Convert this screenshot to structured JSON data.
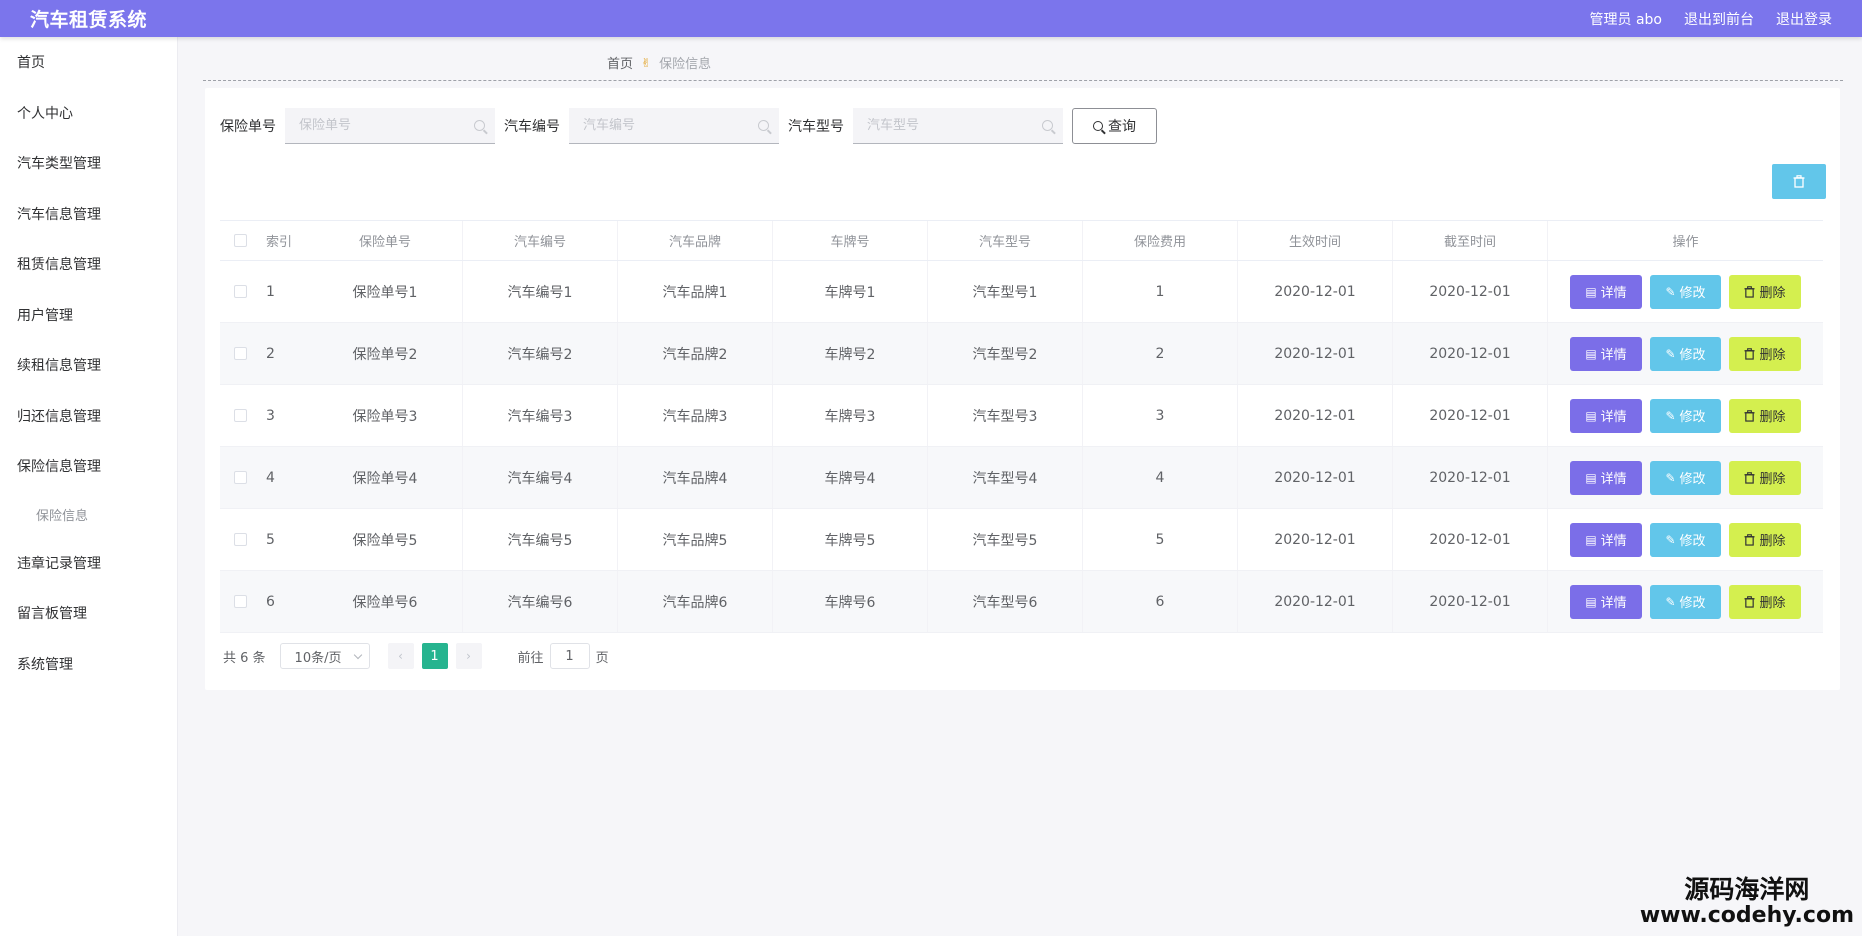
{
  "header": {
    "title": "汽车租赁系统",
    "admin": "管理员 abo",
    "back_to_front": "退出到前台",
    "logout": "退出登录"
  },
  "sidebar": {
    "items": [
      "首页",
      "个人中心",
      "汽车类型管理",
      "汽车信息管理",
      "租赁信息管理",
      "用户管理",
      "续租信息管理",
      "归还信息管理",
      "保险信息管理"
    ],
    "sub_item": "保险信息",
    "items_after": [
      "违章记录管理",
      "留言板管理",
      "系统管理"
    ]
  },
  "breadcrumb": {
    "home": "首页",
    "current": "保险信息"
  },
  "search": {
    "field1_label": "保险单号",
    "field1_placeholder": "保险单号",
    "field2_label": "汽车编号",
    "field2_placeholder": "汽车编号",
    "field3_label": "汽车型号",
    "field3_placeholder": "汽车型号",
    "query_label": "查询"
  },
  "table": {
    "headers": [
      "索引",
      "保险单号",
      "汽车编号",
      "汽车品牌",
      "车牌号",
      "汽车型号",
      "保险费用",
      "生效时间",
      "截至时间",
      "操作"
    ],
    "rows": [
      [
        "1",
        "保险单号1",
        "汽车编号1",
        "汽车品牌1",
        "车牌号1",
        "汽车型号1",
        "1",
        "2020-12-01",
        "2020-12-01"
      ],
      [
        "2",
        "保险单号2",
        "汽车编号2",
        "汽车品牌2",
        "车牌号2",
        "汽车型号2",
        "2",
        "2020-12-01",
        "2020-12-01"
      ],
      [
        "3",
        "保险单号3",
        "汽车编号3",
        "汽车品牌3",
        "车牌号3",
        "汽车型号3",
        "3",
        "2020-12-01",
        "2020-12-01"
      ],
      [
        "4",
        "保险单号4",
        "汽车编号4",
        "汽车品牌4",
        "车牌号4",
        "汽车型号4",
        "4",
        "2020-12-01",
        "2020-12-01"
      ],
      [
        "5",
        "保险单号5",
        "汽车编号5",
        "汽车品牌5",
        "车牌号5",
        "汽车型号5",
        "5",
        "2020-12-01",
        "2020-12-01"
      ],
      [
        "6",
        "保险单号6",
        "汽车编号6",
        "汽车品牌6",
        "车牌号6",
        "汽车型号6",
        "6",
        "2020-12-01",
        "2020-12-01"
      ]
    ],
    "actions": {
      "detail": "详情",
      "edit": "修改",
      "delete": "删除"
    }
  },
  "pagination": {
    "total": "共 6 条",
    "page_size": "10条/页",
    "current_page": "1",
    "goto_prefix": "前往",
    "goto_value": "1",
    "goto_suffix": "页"
  },
  "watermark": {
    "cn": "源码海洋网",
    "url": "www.codehy.com"
  },
  "colors": {
    "header": "#7b75ec",
    "detail_button": "#7b6ee8",
    "edit_button": "#62c6ea",
    "delete_button": "#d4ef4f",
    "active_page": "#26b48f"
  }
}
